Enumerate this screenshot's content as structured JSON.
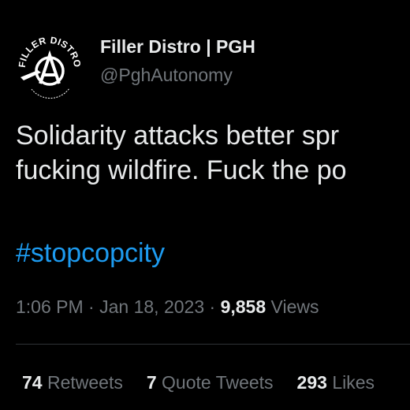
{
  "author": {
    "display_name": "Filler Distro | PGH",
    "handle": "@PghAutonomy",
    "avatar_logo_text": "FILLER DISTRO"
  },
  "tweet": {
    "text_lines": [
      "Solidarity attacks better spr",
      "fucking wildfire. Fuck the po"
    ],
    "hashtag": "#stopcopcity"
  },
  "meta": {
    "time": "1:06 PM",
    "separator": "·",
    "date": "Jan 18, 2023",
    "views_count": "9,858",
    "views_label": "Views"
  },
  "stats": {
    "retweets_count": "74",
    "retweets_label": "Retweets",
    "quotes_count": "7",
    "quotes_label": "Quote Tweets",
    "likes_count": "293",
    "likes_label": "Likes"
  },
  "colors": {
    "background": "#000000",
    "text": "#e7e9ea",
    "muted": "#71767b",
    "link": "#1d9bf0",
    "divider": "#2f3336"
  }
}
